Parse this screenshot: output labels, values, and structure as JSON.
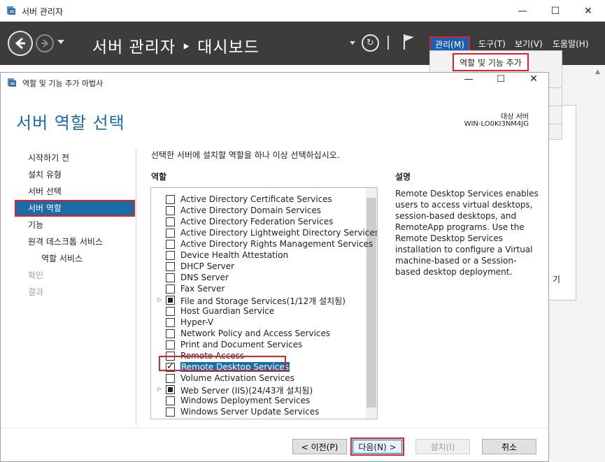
{
  "outer_window": {
    "title": "서버 관리자",
    "min_glyph": "—",
    "max_glyph": "☐",
    "close_glyph": "✕"
  },
  "server_manager_header": {
    "breadcrumb": "서버 관리자 ‣ 대시보드",
    "menu": {
      "manage": "관리(M)",
      "tools": "도구(T)",
      "view": "보기(V)",
      "help": "도움말(H)"
    },
    "manage_dropdown": {
      "add_roles": "역할 및 기능 추가"
    }
  },
  "background_partial_text": "기",
  "wizard": {
    "title": "역할 및 기능 추가 마법사",
    "page_title": "서버 역할 선택",
    "target_label": "대상 서버",
    "target_name": "WIN-LO0KI3NM4JG",
    "instruction": "선택한 서버에 설치할 역할을 하나 이상 선택하십시오.",
    "roles_header": "역할",
    "description_header": "설명",
    "description_text": "Remote Desktop Services enables users to access virtual desktops, session-based desktops, and RemoteApp programs. Use the Remote Desktop Services installation to configure a Virtual machine-based or a Session-based desktop deployment.",
    "steps": [
      {
        "label": "시작하기 전",
        "state": "normal"
      },
      {
        "label": "설치 유형",
        "state": "normal"
      },
      {
        "label": "서버 선택",
        "state": "normal"
      },
      {
        "label": "서버 역할",
        "state": "active"
      },
      {
        "label": "기능",
        "state": "normal"
      },
      {
        "label": "원격 데스크톱 서비스",
        "state": "normal"
      },
      {
        "label": "역할 서비스",
        "state": "sub"
      },
      {
        "label": "확인",
        "state": "disabled"
      },
      {
        "label": "결과",
        "state": "disabled"
      }
    ],
    "roles": [
      {
        "label": "Active Directory Certificate Services",
        "check": "none",
        "expand": false
      },
      {
        "label": "Active Directory Domain Services",
        "check": "none",
        "expand": false
      },
      {
        "label": "Active Directory Federation Services",
        "check": "none",
        "expand": false
      },
      {
        "label": "Active Directory Lightweight Directory Services",
        "check": "none",
        "expand": false
      },
      {
        "label": "Active Directory Rights Management Services",
        "check": "none",
        "expand": false
      },
      {
        "label": "Device Health Attestation",
        "check": "none",
        "expand": false
      },
      {
        "label": "DHCP Server",
        "check": "none",
        "expand": false
      },
      {
        "label": "DNS Server",
        "check": "none",
        "expand": false
      },
      {
        "label": "Fax Server",
        "check": "none",
        "expand": false
      },
      {
        "label": "File and Storage Services(1/12개 설치됨)",
        "check": "partial",
        "expand": true
      },
      {
        "label": "Host Guardian Service",
        "check": "none",
        "expand": false
      },
      {
        "label": "Hyper-V",
        "check": "none",
        "expand": false
      },
      {
        "label": "Network Policy and Access Services",
        "check": "none",
        "expand": false
      },
      {
        "label": "Print and Document Services",
        "check": "none",
        "expand": false
      },
      {
        "label": "Remote Access",
        "check": "none",
        "expand": false
      },
      {
        "label": "Remote Desktop Services",
        "check": "checked",
        "expand": false,
        "selected": true
      },
      {
        "label": "Volume Activation Services",
        "check": "none",
        "expand": false
      },
      {
        "label": "Web Server (IIS)(24/43개 설치됨)",
        "check": "partial",
        "expand": true
      },
      {
        "label": "Windows Deployment Services",
        "check": "none",
        "expand": false
      },
      {
        "label": "Windows Server Update Services",
        "check": "none",
        "expand": false
      }
    ],
    "buttons": {
      "prev": "< 이전(P)",
      "next": "다음(N) >",
      "install": "설치(I)",
      "cancel": "취소"
    }
  }
}
